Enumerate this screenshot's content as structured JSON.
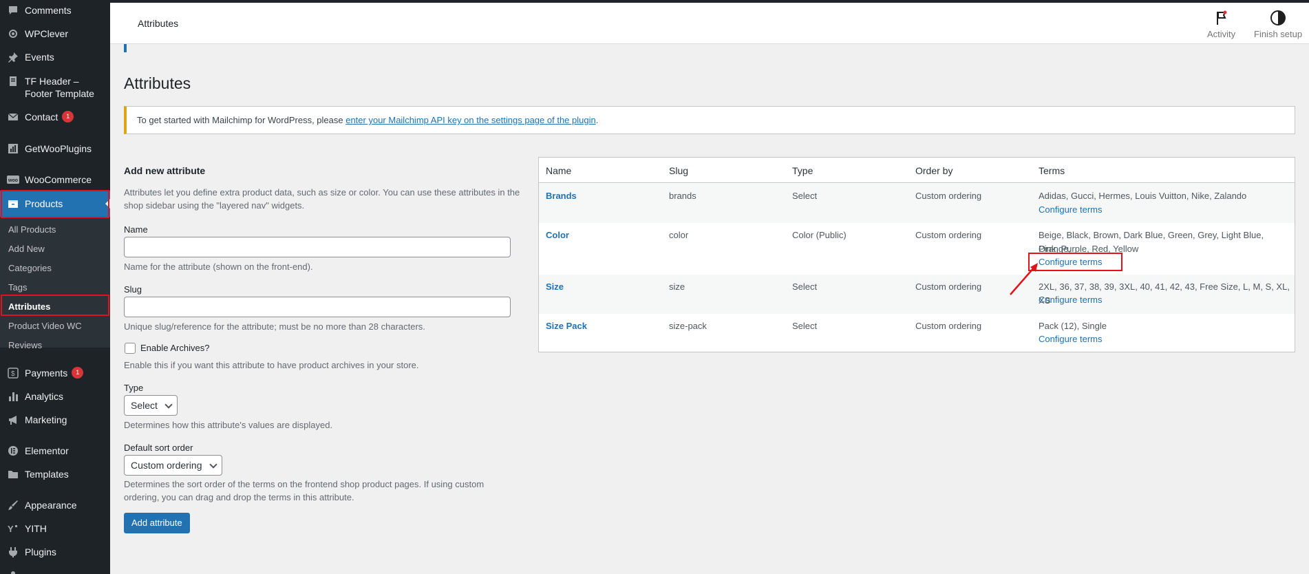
{
  "sidebar": {
    "items": [
      {
        "label": "Comments",
        "icon": "comment-icon"
      },
      {
        "label": "WPClever",
        "icon": "wpclever-icon"
      },
      {
        "label": "Events",
        "icon": "pin-icon"
      },
      {
        "label": "TF Header –",
        "label2": "Footer Template",
        "icon": "page-icon"
      },
      {
        "label": "Contact",
        "icon": "mail-icon",
        "badge": "1"
      },
      {
        "label": "GetWooPlugins",
        "icon": "plugins-grid-icon"
      },
      {
        "label": "WooCommerce",
        "icon": "woo-icon"
      },
      {
        "label": "Products",
        "icon": "products-icon"
      },
      {
        "label": "Payments",
        "icon": "payments-icon",
        "badge": "1"
      },
      {
        "label": "Analytics",
        "icon": "analytics-icon"
      },
      {
        "label": "Marketing",
        "icon": "megaphone-icon"
      },
      {
        "label": "Elementor",
        "icon": "elementor-icon"
      },
      {
        "label": "Templates",
        "icon": "folder-icon"
      },
      {
        "label": "Appearance",
        "icon": "brush-icon"
      },
      {
        "label": "YITH",
        "icon": "yith-icon"
      },
      {
        "label": "Plugins",
        "icon": "plugin-icon"
      }
    ],
    "submenu": [
      "All Products",
      "Add New",
      "Categories",
      "Tags",
      "Attributes",
      "Product Video WC",
      "Reviews"
    ]
  },
  "header": {
    "title": "Attributes",
    "activity": "Activity",
    "finish_setup": "Finish setup"
  },
  "page_title": "Attributes",
  "notice": {
    "text": "To get started with Mailchimp for WordPress, please ",
    "link": "enter your Mailchimp API key on the settings page of the plugin",
    "suffix": "."
  },
  "form": {
    "heading": "Add new attribute",
    "intro": "Attributes let you define extra product data, such as size or color. You can use these attributes in the shop sidebar using the \"layered nav\" widgets.",
    "name_label": "Name",
    "name_help": "Name for the attribute (shown on the front-end).",
    "slug_label": "Slug",
    "slug_help": "Unique slug/reference for the attribute; must be no more than 28 characters.",
    "archives_label": "Enable Archives?",
    "archives_help": "Enable this if you want this attribute to have product archives in your store.",
    "type_label": "Type",
    "type_value": "Select",
    "type_help": "Determines how this attribute's values are displayed.",
    "sort_label": "Default sort order",
    "sort_value": "Custom ordering",
    "sort_help": "Determines the sort order of the terms on the frontend shop product pages. If using custom ordering, you can drag and drop the terms in this attribute.",
    "submit": "Add attribute"
  },
  "table": {
    "headers": [
      "Name",
      "Slug",
      "Type",
      "Order by",
      "Terms"
    ],
    "configure": "Configure terms",
    "rows": [
      {
        "name": "Brands",
        "slug": "brands",
        "type": "Select",
        "order": "Custom ordering",
        "terms": "Adidas, Gucci, Hermes, Louis Vuitton, Nike, Zalando"
      },
      {
        "name": "Color",
        "slug": "color",
        "type": "Color (Public)",
        "order": "Custom ordering",
        "terms": "Beige, Black, Brown, Dark Blue, Green, Grey, Light Blue, Orange,",
        "terms2": "Pink, Purple, Red, Yellow"
      },
      {
        "name": "Size",
        "slug": "size",
        "type": "Select",
        "order": "Custom ordering",
        "terms": "2XL, 36, 37, 38, 39, 3XL, 40, 41, 42, 43, Free Size, L, M, S, XL, XS"
      },
      {
        "name": "Size Pack",
        "slug": "size-pack",
        "type": "Select",
        "order": "Custom ordering",
        "terms": "Pack (12), Single"
      }
    ]
  }
}
